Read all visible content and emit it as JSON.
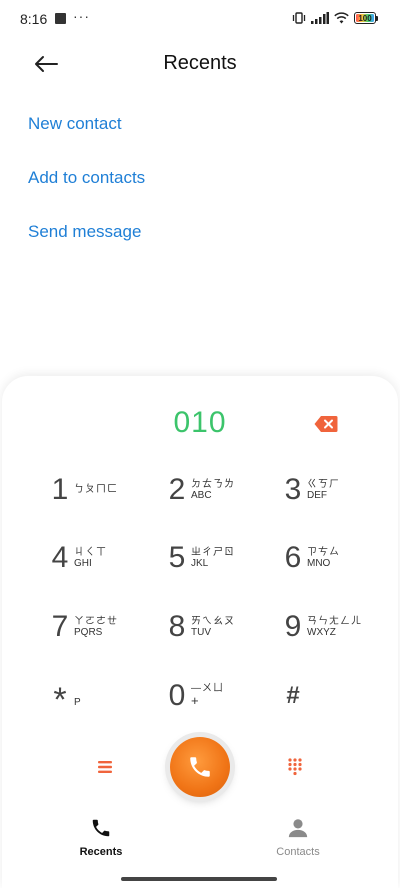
{
  "status_bar": {
    "time": "8:16",
    "dots": "···",
    "battery_level": "100"
  },
  "header": {
    "title": "Recents"
  },
  "actions": [
    {
      "label": "New contact"
    },
    {
      "label": "Add to contacts"
    },
    {
      "label": "Send message"
    }
  ],
  "dialer": {
    "number": "010",
    "keys": [
      {
        "digit": "1",
        "bpmf": "ㄅㄆㄇㄈ",
        "letters": ""
      },
      {
        "digit": "2",
        "bpmf": "ㄉㄊㄋㄌ",
        "letters": "ABC"
      },
      {
        "digit": "3",
        "bpmf": "ㄍㄎㄏ",
        "letters": "DEF"
      },
      {
        "digit": "4",
        "bpmf": "ㄐㄑㄒ",
        "letters": "GHI"
      },
      {
        "digit": "5",
        "bpmf": "ㄓㄔㄕㄖ",
        "letters": "JKL"
      },
      {
        "digit": "6",
        "bpmf": "ㄗㄘㄙ",
        "letters": "MNO"
      },
      {
        "digit": "7",
        "bpmf": "ㄚㄛㄜㄝ",
        "letters": "PQRS"
      },
      {
        "digit": "8",
        "bpmf": "ㄞㄟㄠㄡ",
        "letters": "TUV"
      },
      {
        "digit": "9",
        "bpmf": "ㄢㄣㄤㄥㄦ",
        "letters": "WXYZ"
      },
      {
        "digit": "*",
        "bpmf": "",
        "letters": "P"
      },
      {
        "digit": "0",
        "bpmf": "—ㄨㄩ",
        "letters": "+"
      },
      {
        "digit": "#",
        "bpmf": "",
        "letters": ""
      }
    ]
  },
  "bottom_nav": {
    "tabs": [
      {
        "label": "Recents",
        "icon": "phone-icon"
      },
      {
        "label": "Contacts",
        "icon": "person-icon"
      }
    ]
  },
  "colors": {
    "accent_blue": "#1f7fd6",
    "dialed_green": "#3cc46b",
    "call_orange": "#f07416",
    "delete_red": "#f0643c"
  }
}
